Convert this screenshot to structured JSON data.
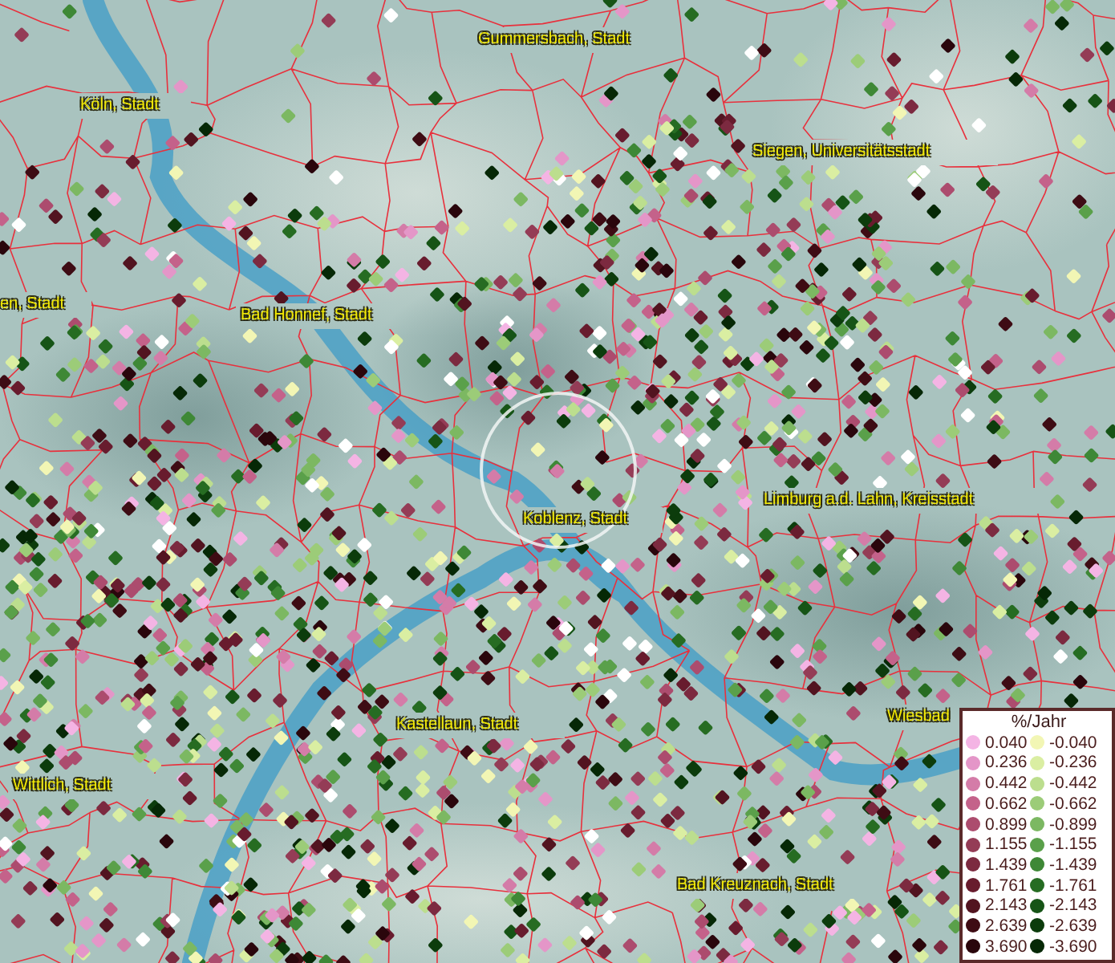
{
  "map_labels": [
    "Köln, Stadt",
    "Gummersbach, Stadt",
    "Siegen, Universitätsstadt",
    "en, Stadt",
    "Bad Honnef, Stadt",
    "Koblenz, Stadt",
    "Limburg a.d. Lahn, Kreisstadt",
    "Kastellaun, Stadt",
    "Wittlich, Stadt",
    "Bad Kreuznach, Stadt",
    "Wiesbad"
  ],
  "legend": {
    "title": "%/Jahr",
    "positive": [
      {
        "label": "0.040",
        "color": "#f4b4e4"
      },
      {
        "label": "0.236",
        "color": "#e496c8"
      },
      {
        "label": "0.442",
        "color": "#d47ca8"
      },
      {
        "label": "0.662",
        "color": "#c4628a"
      },
      {
        "label": "0.899",
        "color": "#ac4c6e"
      },
      {
        "label": "1.155",
        "color": "#943c56"
      },
      {
        "label": "1.439",
        "color": "#7c2a40"
      },
      {
        "label": "1.761",
        "color": "#681c2e"
      },
      {
        "label": "2.143",
        "color": "#521420"
      },
      {
        "label": "2.639",
        "color": "#3e0c14"
      },
      {
        "label": "3.690",
        "color": "#2a060c"
      }
    ],
    "negative": [
      {
        "label": "-0.040",
        "color": "#f2f6b4"
      },
      {
        "label": "-0.236",
        "color": "#daeea2"
      },
      {
        "label": "-0.442",
        "color": "#bcde8e"
      },
      {
        "label": "-0.662",
        "color": "#9ccc78"
      },
      {
        "label": "-0.899",
        "color": "#7cb862"
      },
      {
        "label": "-1.155",
        "color": "#5aa04a"
      },
      {
        "label": "-1.439",
        "color": "#3e8836"
      },
      {
        "label": "-1.761",
        "color": "#266c22"
      },
      {
        "label": "-2.143",
        "color": "#165416"
      },
      {
        "label": "-2.639",
        "color": "#0c3c0c"
      },
      {
        "label": "-3.690",
        "color": "#062806"
      }
    ]
  }
}
